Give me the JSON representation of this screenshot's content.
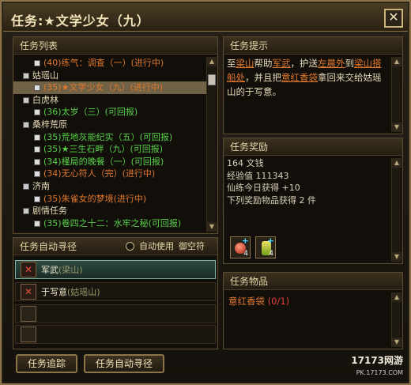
{
  "window": {
    "title": "任务:★文学少女（九）",
    "close_label": "✕"
  },
  "quest_list": {
    "header": "任务列表",
    "rows": [
      {
        "kind": "item",
        "text": "(40)练气：调查（一）(进行中)",
        "color": "orange"
      },
      {
        "kind": "cat",
        "text": "姑瑶山"
      },
      {
        "kind": "item",
        "text": "(35)★文学少女（九）(进行中)",
        "color": "orange",
        "selected": true
      },
      {
        "kind": "cat",
        "text": "白虎林"
      },
      {
        "kind": "item",
        "text": "(36)太岁（三）(可回报)",
        "color": "green"
      },
      {
        "kind": "cat",
        "text": "桑梓荒原"
      },
      {
        "kind": "item",
        "text": "(35)荒地灰能纪实（五）(可回报)",
        "color": "green"
      },
      {
        "kind": "item",
        "text": "(35)★三生石畔（九）(可回报)",
        "color": "green"
      },
      {
        "kind": "item",
        "text": "(34)槿局的晚餐（一）(可回报)",
        "color": "green"
      },
      {
        "kind": "item",
        "text": "(34)无心符人（完）(进行中)",
        "color": "orange"
      },
      {
        "kind": "cat",
        "text": "济南"
      },
      {
        "kind": "item",
        "text": "(35)朱雀女的梦境(进行中)",
        "color": "orange"
      },
      {
        "kind": "cat",
        "text": "剧情任务"
      },
      {
        "kind": "item",
        "text": "(35)卷四之十二：水牢之秘(可回报)",
        "color": "green"
      }
    ]
  },
  "auto_path": {
    "header": "任务自动寻径",
    "auto_use_label": "自动使用",
    "item_name": "御空符",
    "npcs": [
      {
        "name": "军武",
        "location": "(梁山)"
      },
      {
        "name": "于写意",
        "location": "(姑瑶山)"
      }
    ]
  },
  "buttons": {
    "track": "任务追踪",
    "auto_path": "任务自动寻径"
  },
  "tips": {
    "header": "任务提示",
    "parts": {
      "a": "至",
      "b": "梁山",
      "c": "帮助",
      "d": "军武",
      "e": "，护送",
      "f": "左晨外",
      "g": "到",
      "h": "梁山搭船处",
      "i": "，并且把",
      "j": "意红香袋",
      "k": "拿回来交给姑瑶山的于写意。"
    }
  },
  "rewards": {
    "header": "任务奖励",
    "lines": [
      "164 文钱",
      "经验值 111343",
      "仙练今日获得 +10",
      "下列奖励物品获得 2 件"
    ],
    "items": [
      {
        "name": "red-orb-item",
        "count": "4"
      },
      {
        "name": "potion-item",
        "count": "4"
      }
    ]
  },
  "quest_items": {
    "header": "任务物品",
    "item": "意红香袋",
    "progress": "(0/1)"
  },
  "watermark": {
    "brand": "17173网游",
    "site": "PK.17173.COM"
  },
  "colors": {
    "orange": "#e0782c",
    "green": "#58d048",
    "frame": "#8a7448"
  }
}
